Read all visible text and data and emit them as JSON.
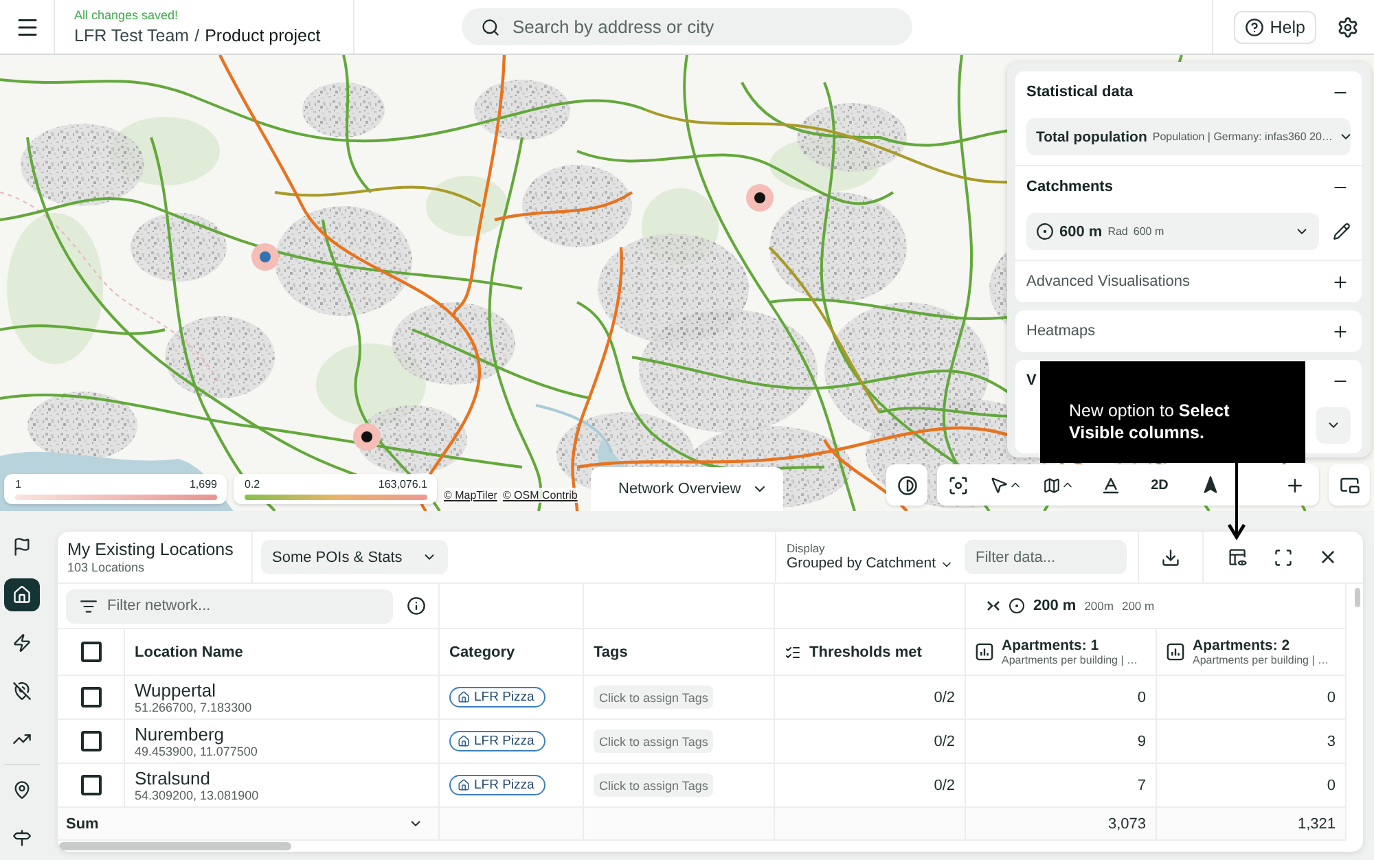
{
  "header": {
    "save_status": "All changes saved!",
    "team": "LFR Test Team",
    "separator": "/",
    "project": "Product project",
    "search": {
      "placeholder": "Search by address or city"
    },
    "help": "Help"
  },
  "map": {
    "markers": [
      {
        "color": "#111111"
      },
      {
        "color": "#111111"
      },
      {
        "color": "#2f73b5"
      }
    ],
    "legends": [
      {
        "kind": "population",
        "min": "1",
        "max": "1,699"
      },
      {
        "kind": "network",
        "min": "0.2",
        "max": "163,076.1"
      }
    ],
    "attribution": [
      "© MapTiler",
      "© OSM Contrib"
    ],
    "view_tab": "Network Overview",
    "view_mode": "2D"
  },
  "side_panel": {
    "cards": [
      {
        "sections": [
          {
            "title": "Statistical data",
            "expanded": true,
            "select": {
              "kind": "dropdown",
              "value": "Total population",
              "detail": "Population | Germany: infas360 20…"
            }
          },
          {
            "title": "Catchments",
            "expanded": true,
            "select": {
              "kind": "catchment",
              "value": "600 m",
              "label": "Rad",
              "detail": "600 m"
            }
          },
          {
            "title": "Advanced Visualisations",
            "expanded": false
          }
        ]
      },
      {
        "sections": [
          {
            "title": "Heatmaps",
            "expanded": false
          }
        ]
      },
      {
        "sections": [
          {
            "title": "V",
            "expanded": true,
            "select": {
              "kind": "dropdown"
            }
          }
        ]
      }
    ]
  },
  "callout": {
    "text": "New option to **Select Visible columns.**"
  },
  "sidebar": {
    "items": [
      {
        "selected": false
      },
      {
        "selected": true
      },
      {
        "selected": false
      },
      {
        "selected": false
      },
      {
        "selected": false
      },
      {
        "selected": false
      },
      {
        "selected": false
      }
    ]
  },
  "panel": {
    "title": "My Existing Locations",
    "count": "103 Locations",
    "preset": "Some POIs & Stats",
    "display": {
      "label": "Display",
      "value": "Grouped by Catchment"
    },
    "filter": {
      "placeholder": "Filter data..."
    }
  },
  "table": {
    "filter": {
      "placeholder": "Filter network..."
    },
    "group": {
      "value": "200 m",
      "detail_1": "200m",
      "detail_2": "200 m"
    },
    "select_all": {
      "checked": false
    },
    "columns": [
      {
        "label": "Location Name",
        "kind": "text"
      },
      {
        "label": "Category",
        "kind": "text"
      },
      {
        "label": "Tags",
        "kind": "text"
      },
      {
        "label": "Thresholds met",
        "kind": "thresholds"
      },
      {
        "label": "Apartments: 1",
        "subtitle": "Apartments per building | …",
        "kind": "metric"
      },
      {
        "label": "Apartments: 2",
        "subtitle": "Apartments per building | …",
        "kind": "metric"
      }
    ],
    "rows": [
      {
        "checked": false,
        "name": "Wuppertal",
        "coordinates": "51.266700, 7.183300",
        "category": "LFR Pizza",
        "tags": "Click to assign Tags",
        "thresholds": "0/2",
        "values": [
          "0",
          "0"
        ]
      },
      {
        "checked": false,
        "name": "Nuremberg",
        "coordinates": "49.453900, 11.077500",
        "category": "LFR Pizza",
        "tags": "Click to assign Tags",
        "thresholds": "0/2",
        "values": [
          "9",
          "3"
        ]
      },
      {
        "checked": false,
        "name": "Stralsund",
        "coordinates": "54.309200, 13.081900",
        "category": "LFR Pizza",
        "tags": "Click to assign Tags",
        "thresholds": "0/2",
        "values": [
          "7",
          "0"
        ]
      }
    ],
    "sum": {
      "label": "Sum",
      "values": [
        "3,073",
        "1,321"
      ]
    }
  }
}
